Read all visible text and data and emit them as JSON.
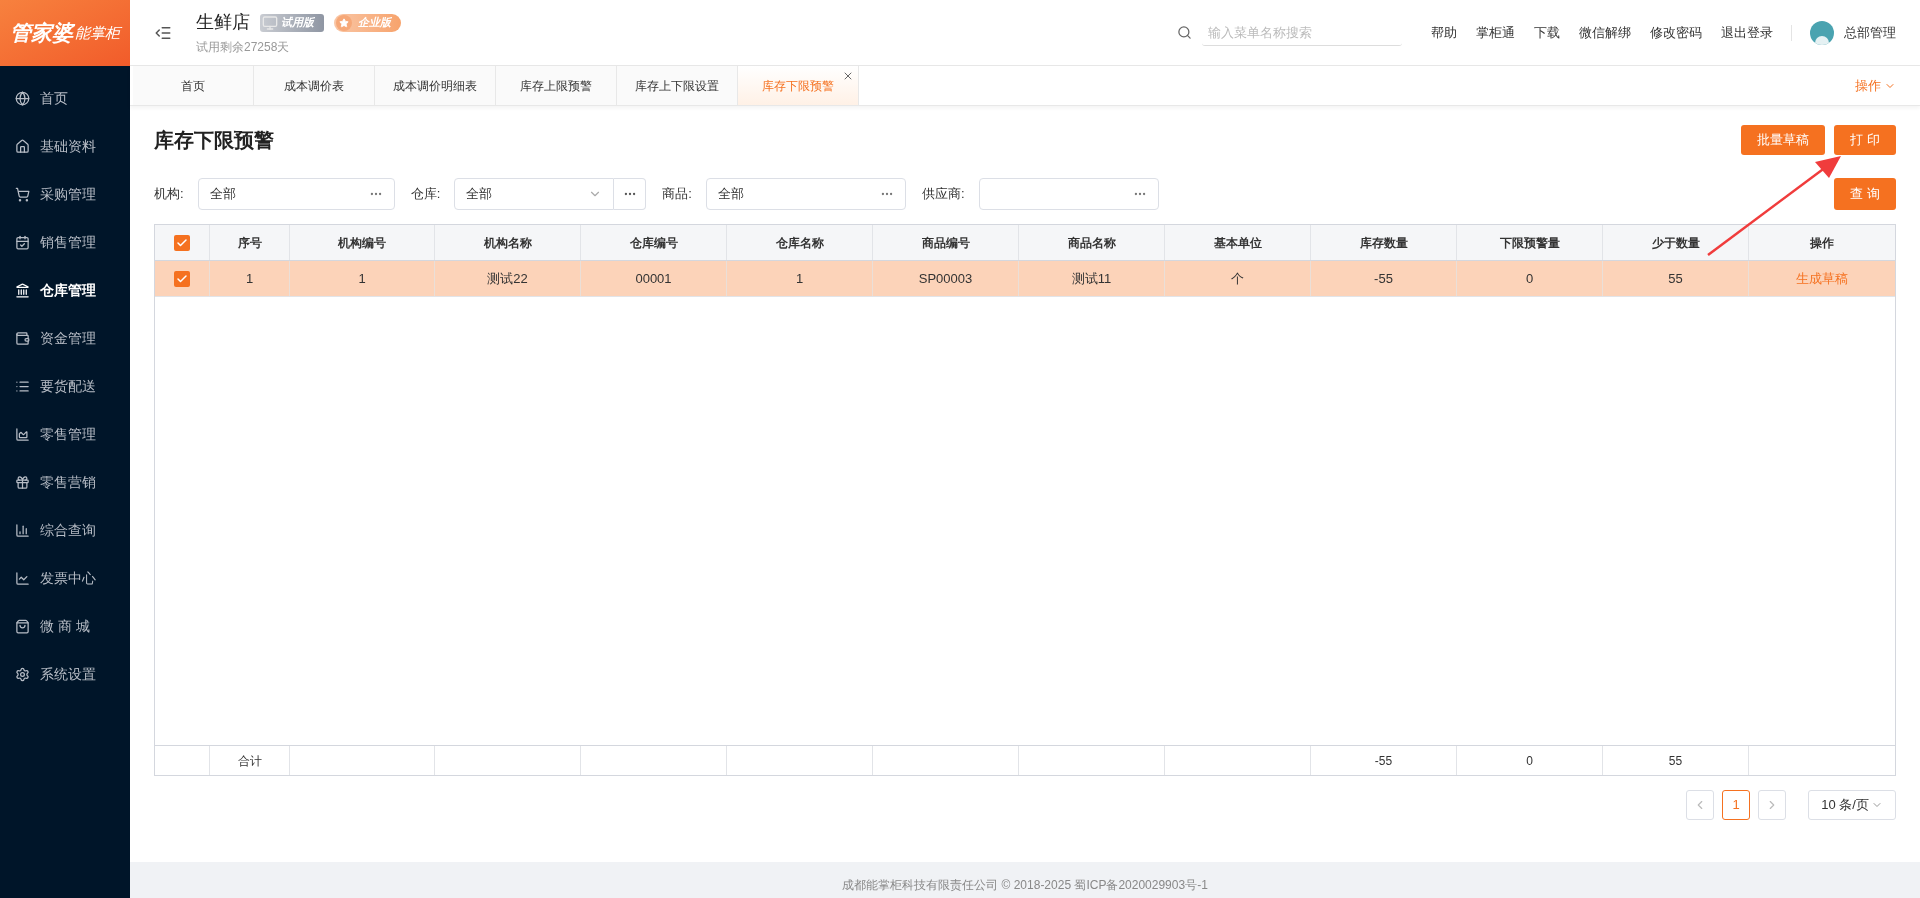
{
  "logo": {
    "main": "管家婆",
    "sub": "能掌柜"
  },
  "sidebar": {
    "items": [
      {
        "label": "首页",
        "selected": false
      },
      {
        "label": "基础资料",
        "selected": false
      },
      {
        "label": "采购管理",
        "selected": false
      },
      {
        "label": "销售管理",
        "selected": false
      },
      {
        "label": "仓库管理",
        "selected": true
      },
      {
        "label": "资金管理",
        "selected": false
      },
      {
        "label": "要货配送",
        "selected": false
      },
      {
        "label": "零售管理",
        "selected": false
      },
      {
        "label": "零售营销",
        "selected": false
      },
      {
        "label": "综合查询",
        "selected": false
      },
      {
        "label": "发票中心",
        "selected": false
      },
      {
        "label": "微 商 城",
        "selected": false
      },
      {
        "label": "系统设置",
        "selected": false
      }
    ]
  },
  "header": {
    "store": "生鲜店",
    "badges": [
      {
        "label": "试用版",
        "kind": "trial"
      },
      {
        "label": "企业版",
        "kind": "enterprise"
      }
    ],
    "trial_note": "试用剩余27258天",
    "search": {
      "placeholder": "输入菜单名称搜索"
    },
    "links": [
      "帮助",
      "掌柜通",
      "下载",
      "微信解绑",
      "修改密码",
      "退出登录"
    ],
    "user": "总部管理"
  },
  "tabs": [
    {
      "label": "首页",
      "selected": false,
      "closable": false
    },
    {
      "label": "成本调价表",
      "selected": false,
      "closable": false
    },
    {
      "label": "成本调价明细表",
      "selected": false,
      "closable": false
    },
    {
      "label": "库存上限预警",
      "selected": false,
      "closable": false
    },
    {
      "label": "库存上下限设置",
      "selected": false,
      "closable": false
    },
    {
      "label": "库存下限预警",
      "selected": true,
      "closable": true
    }
  ],
  "tab_menu": "操作",
  "page": {
    "title": "库存下限预警",
    "buttons": [
      "批量草稿",
      "打 印"
    ],
    "query_button": "查 询",
    "filters": [
      {
        "label": "机构:",
        "value": "全部",
        "kind": "picker"
      },
      {
        "label": "仓库:",
        "value": "全部",
        "kind": "select"
      },
      {
        "label": "商品:",
        "value": "全部",
        "kind": "picker"
      },
      {
        "label": "供应商:",
        "kind": "picker"
      }
    ]
  },
  "table": {
    "header_checked": true,
    "columns": [
      "序号",
      "机构编号",
      "机构名称",
      "仓库编号",
      "仓库名称",
      "商品编号",
      "商品名称",
      "基本单位",
      "库存数量",
      "下限预警量",
      "少于数量",
      "操作"
    ],
    "rows": [
      {
        "checked": true,
        "selected": true,
        "cells": [
          "1",
          "1",
          "测试22",
          "00001",
          "1",
          "SP00003",
          "测试11",
          "个",
          "-55",
          "0",
          "55"
        ],
        "action": "生成草稿"
      }
    ],
    "totals": {
      "label": "合计",
      "cells": [
        "",
        "",
        "",
        "",
        "",
        "",
        "",
        "-55",
        "0",
        "55",
        ""
      ]
    }
  },
  "pagination": {
    "pages": [
      {
        "label": "1",
        "selected": true
      }
    ],
    "page_size": "10 条/页"
  },
  "footer": "成都能掌柜科技有限责任公司 © 2018-2025 蜀ICP备2020029903号-1"
}
